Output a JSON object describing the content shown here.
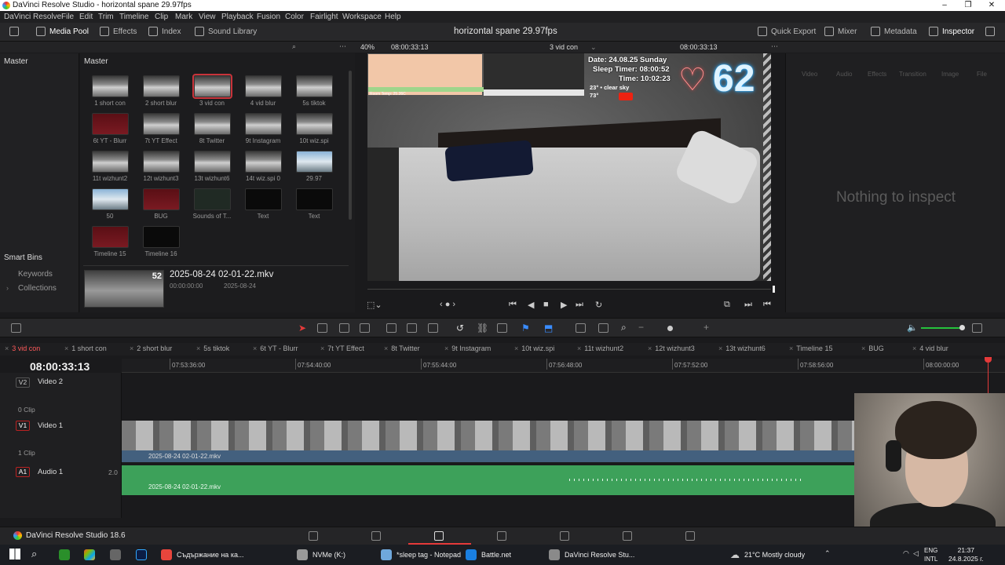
{
  "window": {
    "title": "DaVinci Resolve Studio - horizontal spane 29.97fps",
    "controls": [
      "–",
      "❐",
      "✕"
    ]
  },
  "menu": [
    "DaVinci Resolve",
    "File",
    "Edit",
    "Trim",
    "Timeline",
    "Clip",
    "Mark",
    "View",
    "Playback",
    "Fusion",
    "Color",
    "Fairlight",
    "Workspace",
    "Help"
  ],
  "toolbar": {
    "media_pool": "Media Pool",
    "effects": "Effects",
    "index": "Index",
    "sound_library": "Sound Library",
    "project_title": "horizontal spane 29.97fps",
    "quick_export": "Quick Export",
    "mixer": "Mixer",
    "metadata": "Metadata",
    "inspector": "Inspector"
  },
  "viewer_bar": {
    "zoom": "40%",
    "timecode_left": "08:00:33:13",
    "timeline_name": "3 vid con",
    "timecode_right": "08:00:33:13"
  },
  "sidebar": {
    "master": "Master",
    "smart_bins": "Smart Bins",
    "keywords": "Keywords",
    "collections": "Collections"
  },
  "media_pool": {
    "header": "Master",
    "clips": [
      {
        "label": "1 short con",
        "style": "gray"
      },
      {
        "label": "2 short blur",
        "style": "gray"
      },
      {
        "label": "3 vid con",
        "style": "gray-sel"
      },
      {
        "label": "4 vid blur",
        "style": "gray"
      },
      {
        "label": "5s tiktok",
        "style": "gray"
      },
      {
        "label": "6t YT - Blurr",
        "style": "red"
      },
      {
        "label": "7t YT Effect",
        "style": "gray"
      },
      {
        "label": "8t Twitter",
        "style": "gray"
      },
      {
        "label": "9t Instagram",
        "style": "gray"
      },
      {
        "label": "10t wiz.spi",
        "style": "gray"
      },
      {
        "label": "11t wizhunt2",
        "style": "gray"
      },
      {
        "label": "12t wizhunt3",
        "style": "gray"
      },
      {
        "label": "13t wizhunt6",
        "style": "gray"
      },
      {
        "label": "14t wiz.spi 0",
        "style": "gray"
      },
      {
        "label": "29.97",
        "style": "sky"
      },
      {
        "label": "50",
        "style": "sky"
      },
      {
        "label": "BUG",
        "style": "red"
      },
      {
        "label": "Sounds of T...",
        "style": "sound"
      },
      {
        "label": "Text",
        "style": "dark"
      },
      {
        "label": "Text",
        "style": "dark"
      },
      {
        "label": "Timeline 15",
        "style": "red"
      },
      {
        "label": "Timeline 16",
        "style": "dark"
      }
    ],
    "preview": {
      "name": "2025-08-24 02-01-22.mkv",
      "timecode": "00:00:00:00",
      "date": "2025-08-24",
      "badge": "52"
    }
  },
  "video_overlay": {
    "date": "Date: 24.08.25 Sunday",
    "sleep_timer": "Sleep Timer: 08:00:52",
    "time": "Time: 10:02:23",
    "weather": "23° • clear sky",
    "temp": "73°",
    "heart_rate": "62",
    "room_temp": "Room Temp: 25.26C"
  },
  "inspector": {
    "tabs": [
      "Video",
      "Audio",
      "Effects",
      "Transition",
      "Image",
      "File"
    ],
    "empty": "Nothing to inspect"
  },
  "timeline_tabs": [
    "3 vid con",
    "1 short con",
    "2 short blur",
    "5s tiktok",
    "6t YT - Blurr",
    "7t YT Effect",
    "8t Twitter",
    "9t Instagram",
    "10t wiz.spi",
    "11t wizhunt2",
    "12t wizhunt3",
    "13t wizhunt6",
    "Timeline 15",
    "BUG",
    "4 vid blur"
  ],
  "timeline": {
    "timecode": "08:00:33:13",
    "ruler": [
      "07:53:36:00",
      "07:54:40:00",
      "07:55:44:00",
      "07:56:48:00",
      "07:57:52:00",
      "07:58:56:00",
      "08:00:00:00"
    ],
    "tracks": {
      "v2": {
        "id": "V2",
        "name": "Video 2",
        "info": "0 Clip"
      },
      "v1": {
        "id": "V1",
        "name": "Video 1",
        "info": "1 Clip",
        "clip": "2025-08-24 02-01-22.mkv"
      },
      "a1": {
        "id": "A1",
        "name": "Audio 1",
        "level": "2.0",
        "clip": "2025-08-24 02-01-22.mkv"
      }
    }
  },
  "pagebar": {
    "brand": "DaVinci Resolve Studio 18.6"
  },
  "taskbar": {
    "apps": [
      {
        "label": "Съдържание на ка...",
        "color": "#e8453c"
      },
      {
        "label": "NVMe (K:)",
        "color": "#999999"
      },
      {
        "label": "*sleep tag - Notepad",
        "color": "#6fa8dc"
      },
      {
        "label": "Battle.net",
        "color": "#1a7fe0"
      },
      {
        "label": "DaVinci Resolve Stu...",
        "color": "#8a8a8a"
      }
    ],
    "weather": "21°C  Mostly cloudy",
    "lang_top": "ENG",
    "lang_bottom": "INTL",
    "time": "21:37",
    "date": "24.8.2025 г."
  }
}
